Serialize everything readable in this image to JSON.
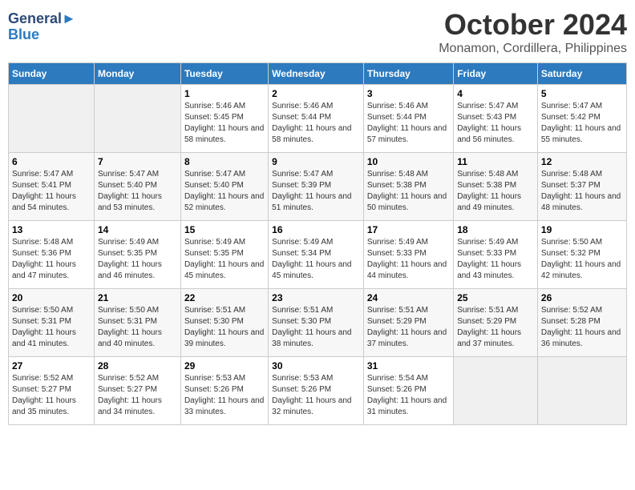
{
  "logo": {
    "line1": "General",
    "line2": "Blue"
  },
  "title": "October 2024",
  "subtitle": "Monamon, Cordillera, Philippines",
  "headers": [
    "Sunday",
    "Monday",
    "Tuesday",
    "Wednesday",
    "Thursday",
    "Friday",
    "Saturday"
  ],
  "weeks": [
    [
      {
        "day": "",
        "empty": true
      },
      {
        "day": "",
        "empty": true
      },
      {
        "day": "1",
        "sunrise": "Sunrise: 5:46 AM",
        "sunset": "Sunset: 5:45 PM",
        "daylight": "Daylight: 11 hours and 58 minutes."
      },
      {
        "day": "2",
        "sunrise": "Sunrise: 5:46 AM",
        "sunset": "Sunset: 5:44 PM",
        "daylight": "Daylight: 11 hours and 58 minutes."
      },
      {
        "day": "3",
        "sunrise": "Sunrise: 5:46 AM",
        "sunset": "Sunset: 5:44 PM",
        "daylight": "Daylight: 11 hours and 57 minutes."
      },
      {
        "day": "4",
        "sunrise": "Sunrise: 5:47 AM",
        "sunset": "Sunset: 5:43 PM",
        "daylight": "Daylight: 11 hours and 56 minutes."
      },
      {
        "day": "5",
        "sunrise": "Sunrise: 5:47 AM",
        "sunset": "Sunset: 5:42 PM",
        "daylight": "Daylight: 11 hours and 55 minutes."
      }
    ],
    [
      {
        "day": "6",
        "sunrise": "Sunrise: 5:47 AM",
        "sunset": "Sunset: 5:41 PM",
        "daylight": "Daylight: 11 hours and 54 minutes."
      },
      {
        "day": "7",
        "sunrise": "Sunrise: 5:47 AM",
        "sunset": "Sunset: 5:40 PM",
        "daylight": "Daylight: 11 hours and 53 minutes."
      },
      {
        "day": "8",
        "sunrise": "Sunrise: 5:47 AM",
        "sunset": "Sunset: 5:40 PM",
        "daylight": "Daylight: 11 hours and 52 minutes."
      },
      {
        "day": "9",
        "sunrise": "Sunrise: 5:47 AM",
        "sunset": "Sunset: 5:39 PM",
        "daylight": "Daylight: 11 hours and 51 minutes."
      },
      {
        "day": "10",
        "sunrise": "Sunrise: 5:48 AM",
        "sunset": "Sunset: 5:38 PM",
        "daylight": "Daylight: 11 hours and 50 minutes."
      },
      {
        "day": "11",
        "sunrise": "Sunrise: 5:48 AM",
        "sunset": "Sunset: 5:38 PM",
        "daylight": "Daylight: 11 hours and 49 minutes."
      },
      {
        "day": "12",
        "sunrise": "Sunrise: 5:48 AM",
        "sunset": "Sunset: 5:37 PM",
        "daylight": "Daylight: 11 hours and 48 minutes."
      }
    ],
    [
      {
        "day": "13",
        "sunrise": "Sunrise: 5:48 AM",
        "sunset": "Sunset: 5:36 PM",
        "daylight": "Daylight: 11 hours and 47 minutes."
      },
      {
        "day": "14",
        "sunrise": "Sunrise: 5:49 AM",
        "sunset": "Sunset: 5:35 PM",
        "daylight": "Daylight: 11 hours and 46 minutes."
      },
      {
        "day": "15",
        "sunrise": "Sunrise: 5:49 AM",
        "sunset": "Sunset: 5:35 PM",
        "daylight": "Daylight: 11 hours and 45 minutes."
      },
      {
        "day": "16",
        "sunrise": "Sunrise: 5:49 AM",
        "sunset": "Sunset: 5:34 PM",
        "daylight": "Daylight: 11 hours and 45 minutes."
      },
      {
        "day": "17",
        "sunrise": "Sunrise: 5:49 AM",
        "sunset": "Sunset: 5:33 PM",
        "daylight": "Daylight: 11 hours and 44 minutes."
      },
      {
        "day": "18",
        "sunrise": "Sunrise: 5:49 AM",
        "sunset": "Sunset: 5:33 PM",
        "daylight": "Daylight: 11 hours and 43 minutes."
      },
      {
        "day": "19",
        "sunrise": "Sunrise: 5:50 AM",
        "sunset": "Sunset: 5:32 PM",
        "daylight": "Daylight: 11 hours and 42 minutes."
      }
    ],
    [
      {
        "day": "20",
        "sunrise": "Sunrise: 5:50 AM",
        "sunset": "Sunset: 5:31 PM",
        "daylight": "Daylight: 11 hours and 41 minutes."
      },
      {
        "day": "21",
        "sunrise": "Sunrise: 5:50 AM",
        "sunset": "Sunset: 5:31 PM",
        "daylight": "Daylight: 11 hours and 40 minutes."
      },
      {
        "day": "22",
        "sunrise": "Sunrise: 5:51 AM",
        "sunset": "Sunset: 5:30 PM",
        "daylight": "Daylight: 11 hours and 39 minutes."
      },
      {
        "day": "23",
        "sunrise": "Sunrise: 5:51 AM",
        "sunset": "Sunset: 5:30 PM",
        "daylight": "Daylight: 11 hours and 38 minutes."
      },
      {
        "day": "24",
        "sunrise": "Sunrise: 5:51 AM",
        "sunset": "Sunset: 5:29 PM",
        "daylight": "Daylight: 11 hours and 37 minutes."
      },
      {
        "day": "25",
        "sunrise": "Sunrise: 5:51 AM",
        "sunset": "Sunset: 5:29 PM",
        "daylight": "Daylight: 11 hours and 37 minutes."
      },
      {
        "day": "26",
        "sunrise": "Sunrise: 5:52 AM",
        "sunset": "Sunset: 5:28 PM",
        "daylight": "Daylight: 11 hours and 36 minutes."
      }
    ],
    [
      {
        "day": "27",
        "sunrise": "Sunrise: 5:52 AM",
        "sunset": "Sunset: 5:27 PM",
        "daylight": "Daylight: 11 hours and 35 minutes."
      },
      {
        "day": "28",
        "sunrise": "Sunrise: 5:52 AM",
        "sunset": "Sunset: 5:27 PM",
        "daylight": "Daylight: 11 hours and 34 minutes."
      },
      {
        "day": "29",
        "sunrise": "Sunrise: 5:53 AM",
        "sunset": "Sunset: 5:26 PM",
        "daylight": "Daylight: 11 hours and 33 minutes."
      },
      {
        "day": "30",
        "sunrise": "Sunrise: 5:53 AM",
        "sunset": "Sunset: 5:26 PM",
        "daylight": "Daylight: 11 hours and 32 minutes."
      },
      {
        "day": "31",
        "sunrise": "Sunrise: 5:54 AM",
        "sunset": "Sunset: 5:26 PM",
        "daylight": "Daylight: 11 hours and 31 minutes."
      },
      {
        "day": "",
        "empty": true
      },
      {
        "day": "",
        "empty": true
      }
    ]
  ]
}
